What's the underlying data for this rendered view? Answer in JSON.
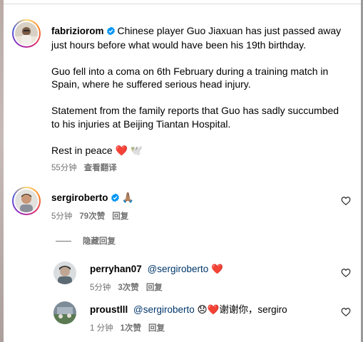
{
  "post": {
    "username": "fabriziorom",
    "lines": [
      "Chinese player Guo Jiaxuan has just passed away",
      "just hours before what would have been his 19th birthday."
    ],
    "para2": [
      "Guo fell into a coma on 6th February during a training match in",
      "Spain, where he suffered serious head injury."
    ],
    "para3": [
      "Statement from the family reports that Guo has sadly succumbed",
      "to his injuries at Beijing Tiantan Hospital."
    ],
    "para4": "Rest in peace ❤️ 🕊️",
    "time": "55分钟",
    "see_translation": "查看翻译"
  },
  "comments": [
    {
      "username": "sergiroberto",
      "text": "🙏🏽",
      "time": "5分钟",
      "likes": "79次赞",
      "reply": "回复"
    }
  ],
  "hide_replies": "隐藏回复",
  "replies": [
    {
      "username": "perryhan07",
      "mention": "@sergiroberto",
      "text": "❤️",
      "time": "5分钟",
      "likes": "3次赞",
      "reply": "回复"
    },
    {
      "username": "proustlll",
      "mention": "@sergiroberto",
      "text": "😞❤️谢谢你，sergiro",
      "time": "1 分钟",
      "likes": "1次赞",
      "reply": "回复"
    }
  ],
  "colors": {
    "verified": "#0095f6",
    "meta": "#737373",
    "mention": "#00376b"
  }
}
